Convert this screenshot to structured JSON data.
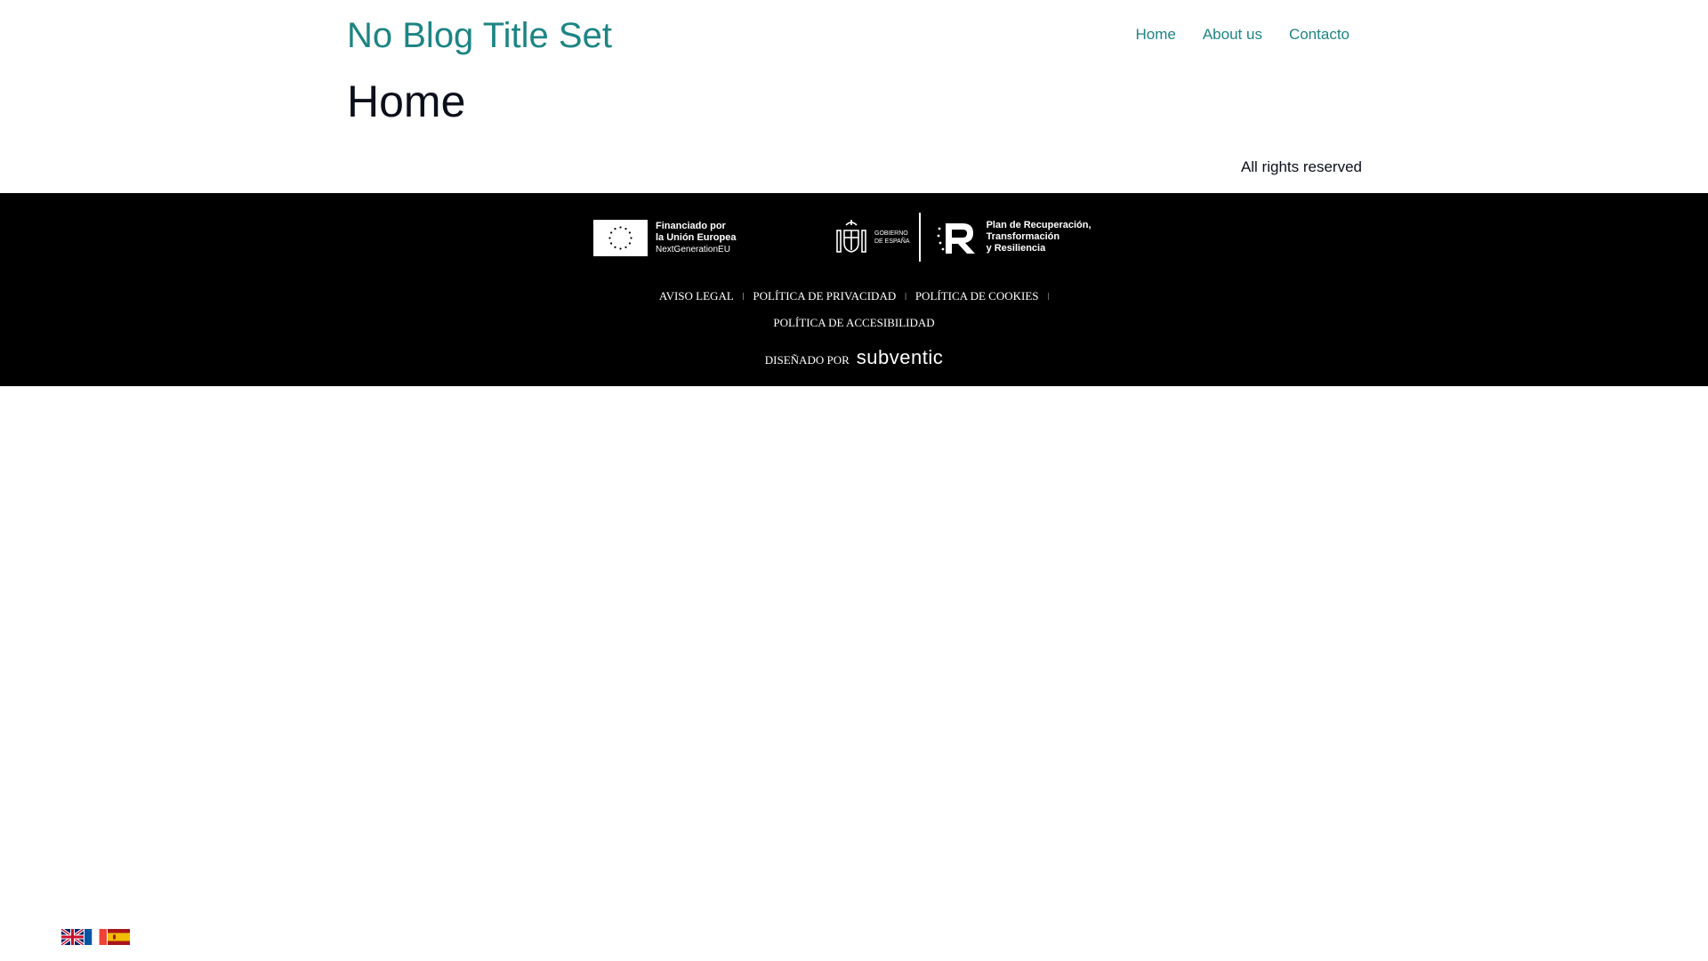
{
  "header": {
    "site_title": "No Blog Title Set",
    "nav": [
      {
        "label": "Home"
      },
      {
        "label": "About us"
      },
      {
        "label": "Contacto"
      }
    ]
  },
  "main": {
    "page_title": "Home",
    "rights": "All rights reserved"
  },
  "footer": {
    "eu_logo": {
      "line1": "Financiado por",
      "line2": "la Unión Europea",
      "line3": "NextGenerationEU"
    },
    "gov_logo": {
      "line1": "GOBIERNO",
      "line2": "DE ESPAÑA"
    },
    "prtr_logo": {
      "line1": "Plan de Recuperación,",
      "line2": "Transformación",
      "line3": "y Resiliencia"
    },
    "links": [
      {
        "label": "AVISO LEGAL"
      },
      {
        "label": "POLÍTICA DE PRIVACIDAD"
      },
      {
        "label": "POLÍTICA DE COOKIES"
      },
      {
        "label": "POLÍTICA DE ACCESIBILIDAD"
      }
    ],
    "designed_by_label": "DISEÑADO POR",
    "designed_by_brand": "subventic"
  },
  "language_switcher": [
    {
      "icon": "flag-uk-icon"
    },
    {
      "icon": "flag-france-icon"
    },
    {
      "icon": "flag-spain-icon"
    }
  ],
  "colors": {
    "accent": "#1d8584",
    "footer_bg": "#000000",
    "text_dark": "#0b0f1a"
  }
}
